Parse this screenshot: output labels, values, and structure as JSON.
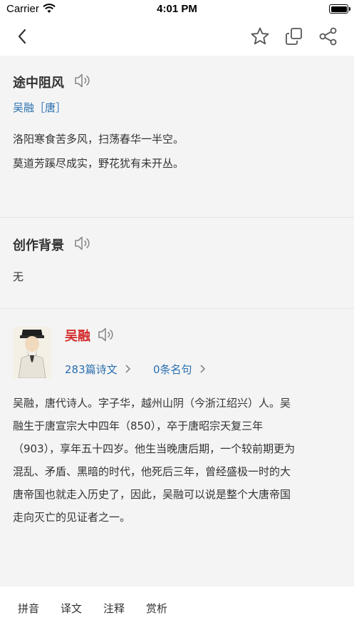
{
  "status": {
    "carrier": "Carrier",
    "time": "4:01 PM"
  },
  "nav": {
    "icons": [
      "back-arrow-icon",
      "star-icon",
      "copy-icon",
      "share-icon"
    ]
  },
  "poem": {
    "title": "途中阻风",
    "author_dynasty": "吴融［唐］",
    "lines": [
      "洛阳寒食苦多风，扫荡春华一半空。",
      "莫道芳蹊尽成实，野花犹有未开丛。"
    ]
  },
  "background": {
    "title": "创作背景",
    "text": "无"
  },
  "poet": {
    "name": "吴融",
    "works_link": "283篇诗文",
    "quotes_link": "0条名句",
    "bio_lines": [
      "吴融，唐代诗人。字子华，越州山阴（今浙江绍兴）人。吴",
      "融生于唐宣宗大中四年（850），卒于唐昭宗天复三年",
      "（903），享年五十四岁。他生当晚唐后期，一个较前期更为",
      "混乱、矛盾、黑暗的时代，他死后三年，曾经盛极一时的大",
      "唐帝国也就走入历史了，因此，吴融可以说是整个大唐帝国",
      "走向灭亡的见证者之一。"
    ]
  },
  "tabs": [
    "拼音",
    "译文",
    "注释",
    "赏析"
  ],
  "colors": {
    "link": "#2a6fb0",
    "poet_name": "#d32b2b",
    "background": "#f4f4f4"
  }
}
